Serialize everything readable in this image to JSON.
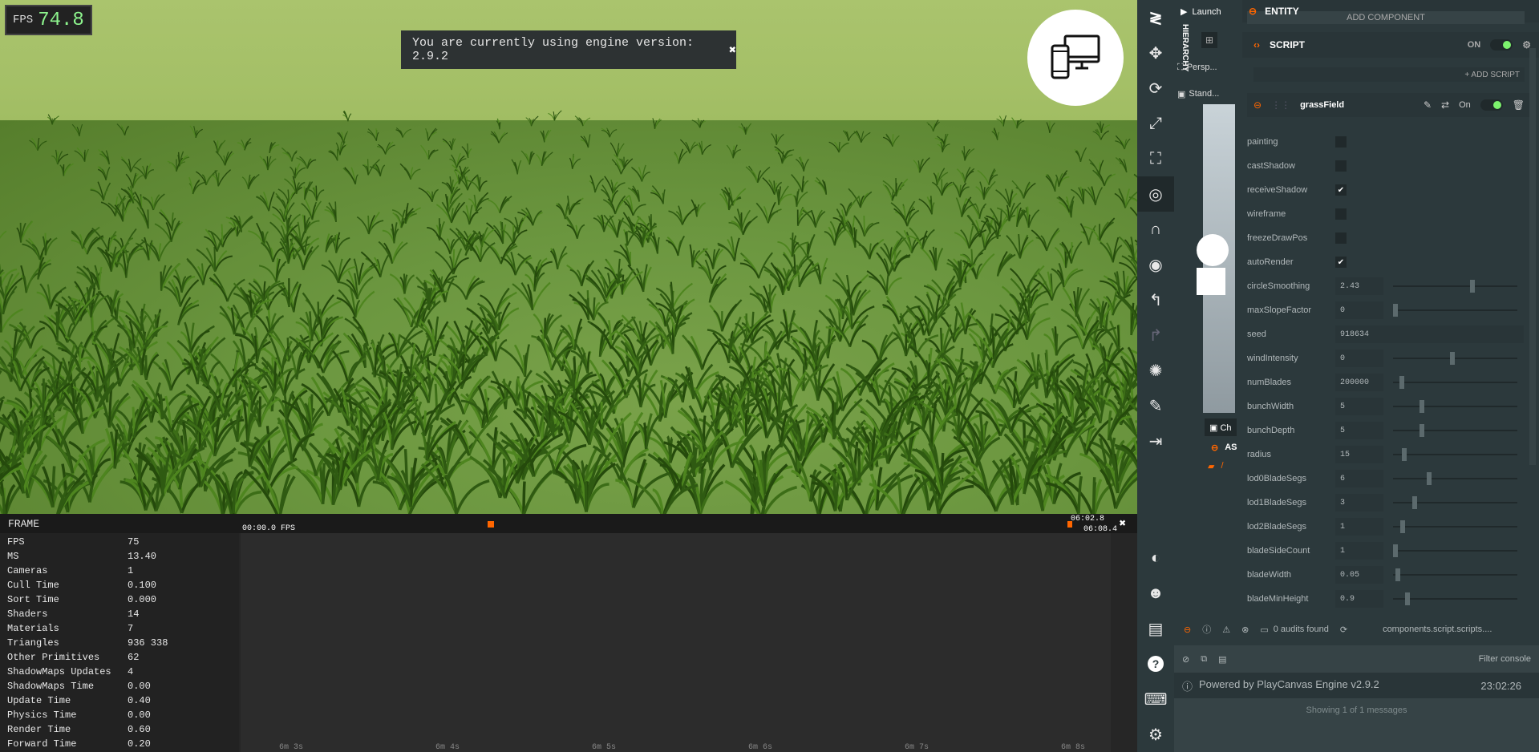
{
  "viewport": {
    "fps_label": "FPS",
    "fps_value": "74.8",
    "notice": "You are currently using engine version: 2.9.2",
    "notice_close": "✖"
  },
  "profiler": {
    "title": "FRAME",
    "close": "✖",
    "timeline_start": "00:00.0 FPS",
    "timeline_end_top": "06:02.8",
    "timeline_end_bottom": "06:08.4",
    "ticks": [
      "6m 3s",
      "6m 4s",
      "6m 5s",
      "6m 6s",
      "6m 7s",
      "6m 8s"
    ],
    "stats": [
      {
        "name": "FPS",
        "value": "75"
      },
      {
        "name": "MS",
        "value": "13.40"
      },
      {
        "name": "Cameras",
        "value": "1"
      },
      {
        "name": "Cull Time",
        "value": "0.100"
      },
      {
        "name": "Sort Time",
        "value": "0.000"
      },
      {
        "name": "Shaders",
        "value": "14"
      },
      {
        "name": "Materials",
        "value": "7"
      },
      {
        "name": "Triangles",
        "value": "936 338"
      },
      {
        "name": "Other Primitives",
        "value": "62"
      },
      {
        "name": "ShadowMaps Updates",
        "value": "4"
      },
      {
        "name": "ShadowMaps Time",
        "value": "0.00"
      },
      {
        "name": "Update Time",
        "value": "0.40"
      },
      {
        "name": "Physics Time",
        "value": "0.00"
      },
      {
        "name": "Render Time",
        "value": "0.60"
      },
      {
        "name": "Forward Time",
        "value": "0.20"
      }
    ]
  },
  "hierarchy": {
    "launch": "Launch",
    "tab": "HIERARCHY",
    "items": [
      "Persp...",
      "Stand..."
    ],
    "assets_label": "AS",
    "folder": "/"
  },
  "inspector": {
    "entity": "ENTITY",
    "add_component": "ADD COMPONENT",
    "script": "SCRIPT",
    "script_on": "ON",
    "add_script": "+ ADD SCRIPT",
    "script_name": "grassField",
    "script_state": "On",
    "attributes": [
      {
        "label": "painting",
        "kind": "checkbox",
        "checked": false
      },
      {
        "label": "castShadow",
        "kind": "checkbox",
        "checked": false
      },
      {
        "label": "receiveShadow",
        "kind": "checkbox",
        "checked": true
      },
      {
        "label": "wireframe",
        "kind": "checkbox",
        "checked": false
      },
      {
        "label": "freezeDrawPos",
        "kind": "checkbox",
        "checked": false
      },
      {
        "label": "autoRender",
        "kind": "checkbox",
        "checked": true
      },
      {
        "label": "circleSmoothing",
        "kind": "slider",
        "value": "2.43",
        "fraction": 0.64
      },
      {
        "label": "maxSlopeFactor",
        "kind": "slider",
        "value": "0",
        "fraction": 0.0
      },
      {
        "label": "seed",
        "kind": "field",
        "value": "918634"
      },
      {
        "label": "windIntensity",
        "kind": "slider",
        "value": "0",
        "fraction": 0.47
      },
      {
        "label": "numBlades",
        "kind": "slider",
        "value": "200000",
        "fraction": 0.05
      },
      {
        "label": "bunchWidth",
        "kind": "slider",
        "value": "5",
        "fraction": 0.22
      },
      {
        "label": "bunchDepth",
        "kind": "slider",
        "value": "5",
        "fraction": 0.22
      },
      {
        "label": "radius",
        "kind": "slider",
        "value": "15",
        "fraction": 0.07
      },
      {
        "label": "lod0BladeSegs",
        "kind": "slider",
        "value": "6",
        "fraction": 0.28
      },
      {
        "label": "lod1BladeSegs",
        "kind": "slider",
        "value": "3",
        "fraction": 0.16
      },
      {
        "label": "lod2BladeSegs",
        "kind": "slider",
        "value": "1",
        "fraction": 0.06
      },
      {
        "label": "bladeSideCount",
        "kind": "slider",
        "value": "1",
        "fraction": 0.0
      },
      {
        "label": "bladeWidth",
        "kind": "slider",
        "value": "0.05",
        "fraction": 0.02
      },
      {
        "label": "bladeMinHeight",
        "kind": "slider",
        "value": "0.9",
        "fraction": 0.1
      }
    ]
  },
  "console": {
    "audits": "0 audits found",
    "path": "components.script.scripts....",
    "filter": "Filter console",
    "message": "Powered by PlayCanvas Engine v2.9.2",
    "time": "23:02:26",
    "footer": "Showing 1 of 1 messages"
  },
  "colors": {
    "accent": "#ff6600",
    "toggle_on": "#7cf26d",
    "panel": "#2c393c"
  }
}
